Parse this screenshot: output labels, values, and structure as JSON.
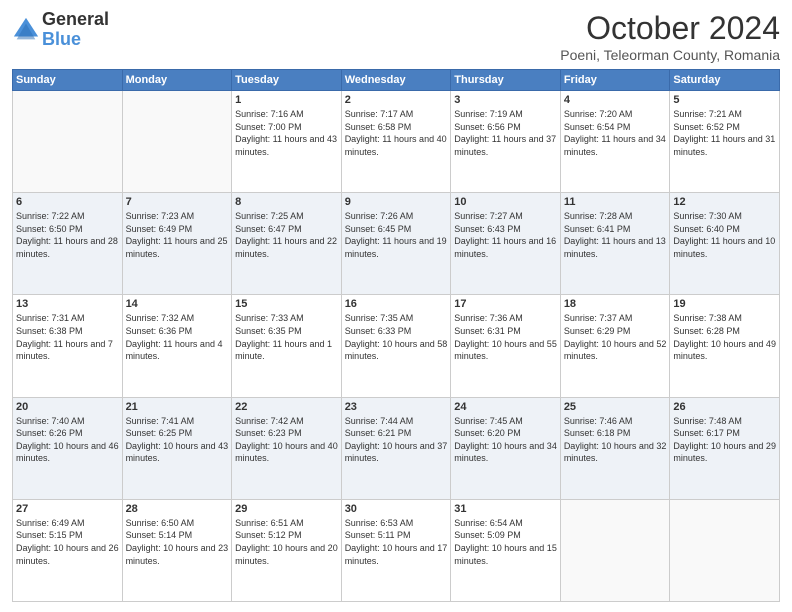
{
  "header": {
    "logo_general": "General",
    "logo_blue": "Blue",
    "month_title": "October 2024",
    "location": "Poeni, Teleorman County, Romania"
  },
  "days_of_week": [
    "Sunday",
    "Monday",
    "Tuesday",
    "Wednesday",
    "Thursday",
    "Friday",
    "Saturday"
  ],
  "weeks": [
    [
      {
        "num": "",
        "info": ""
      },
      {
        "num": "",
        "info": ""
      },
      {
        "num": "1",
        "info": "Sunrise: 7:16 AM\nSunset: 7:00 PM\nDaylight: 11 hours and 43 minutes."
      },
      {
        "num": "2",
        "info": "Sunrise: 7:17 AM\nSunset: 6:58 PM\nDaylight: 11 hours and 40 minutes."
      },
      {
        "num": "3",
        "info": "Sunrise: 7:19 AM\nSunset: 6:56 PM\nDaylight: 11 hours and 37 minutes."
      },
      {
        "num": "4",
        "info": "Sunrise: 7:20 AM\nSunset: 6:54 PM\nDaylight: 11 hours and 34 minutes."
      },
      {
        "num": "5",
        "info": "Sunrise: 7:21 AM\nSunset: 6:52 PM\nDaylight: 11 hours and 31 minutes."
      }
    ],
    [
      {
        "num": "6",
        "info": "Sunrise: 7:22 AM\nSunset: 6:50 PM\nDaylight: 11 hours and 28 minutes."
      },
      {
        "num": "7",
        "info": "Sunrise: 7:23 AM\nSunset: 6:49 PM\nDaylight: 11 hours and 25 minutes."
      },
      {
        "num": "8",
        "info": "Sunrise: 7:25 AM\nSunset: 6:47 PM\nDaylight: 11 hours and 22 minutes."
      },
      {
        "num": "9",
        "info": "Sunrise: 7:26 AM\nSunset: 6:45 PM\nDaylight: 11 hours and 19 minutes."
      },
      {
        "num": "10",
        "info": "Sunrise: 7:27 AM\nSunset: 6:43 PM\nDaylight: 11 hours and 16 minutes."
      },
      {
        "num": "11",
        "info": "Sunrise: 7:28 AM\nSunset: 6:41 PM\nDaylight: 11 hours and 13 minutes."
      },
      {
        "num": "12",
        "info": "Sunrise: 7:30 AM\nSunset: 6:40 PM\nDaylight: 11 hours and 10 minutes."
      }
    ],
    [
      {
        "num": "13",
        "info": "Sunrise: 7:31 AM\nSunset: 6:38 PM\nDaylight: 11 hours and 7 minutes."
      },
      {
        "num": "14",
        "info": "Sunrise: 7:32 AM\nSunset: 6:36 PM\nDaylight: 11 hours and 4 minutes."
      },
      {
        "num": "15",
        "info": "Sunrise: 7:33 AM\nSunset: 6:35 PM\nDaylight: 11 hours and 1 minute."
      },
      {
        "num": "16",
        "info": "Sunrise: 7:35 AM\nSunset: 6:33 PM\nDaylight: 10 hours and 58 minutes."
      },
      {
        "num": "17",
        "info": "Sunrise: 7:36 AM\nSunset: 6:31 PM\nDaylight: 10 hours and 55 minutes."
      },
      {
        "num": "18",
        "info": "Sunrise: 7:37 AM\nSunset: 6:29 PM\nDaylight: 10 hours and 52 minutes."
      },
      {
        "num": "19",
        "info": "Sunrise: 7:38 AM\nSunset: 6:28 PM\nDaylight: 10 hours and 49 minutes."
      }
    ],
    [
      {
        "num": "20",
        "info": "Sunrise: 7:40 AM\nSunset: 6:26 PM\nDaylight: 10 hours and 46 minutes."
      },
      {
        "num": "21",
        "info": "Sunrise: 7:41 AM\nSunset: 6:25 PM\nDaylight: 10 hours and 43 minutes."
      },
      {
        "num": "22",
        "info": "Sunrise: 7:42 AM\nSunset: 6:23 PM\nDaylight: 10 hours and 40 minutes."
      },
      {
        "num": "23",
        "info": "Sunrise: 7:44 AM\nSunset: 6:21 PM\nDaylight: 10 hours and 37 minutes."
      },
      {
        "num": "24",
        "info": "Sunrise: 7:45 AM\nSunset: 6:20 PM\nDaylight: 10 hours and 34 minutes."
      },
      {
        "num": "25",
        "info": "Sunrise: 7:46 AM\nSunset: 6:18 PM\nDaylight: 10 hours and 32 minutes."
      },
      {
        "num": "26",
        "info": "Sunrise: 7:48 AM\nSunset: 6:17 PM\nDaylight: 10 hours and 29 minutes."
      }
    ],
    [
      {
        "num": "27",
        "info": "Sunrise: 6:49 AM\nSunset: 5:15 PM\nDaylight: 10 hours and 26 minutes."
      },
      {
        "num": "28",
        "info": "Sunrise: 6:50 AM\nSunset: 5:14 PM\nDaylight: 10 hours and 23 minutes."
      },
      {
        "num": "29",
        "info": "Sunrise: 6:51 AM\nSunset: 5:12 PM\nDaylight: 10 hours and 20 minutes."
      },
      {
        "num": "30",
        "info": "Sunrise: 6:53 AM\nSunset: 5:11 PM\nDaylight: 10 hours and 17 minutes."
      },
      {
        "num": "31",
        "info": "Sunrise: 6:54 AM\nSunset: 5:09 PM\nDaylight: 10 hours and 15 minutes."
      },
      {
        "num": "",
        "info": ""
      },
      {
        "num": "",
        "info": ""
      }
    ]
  ]
}
